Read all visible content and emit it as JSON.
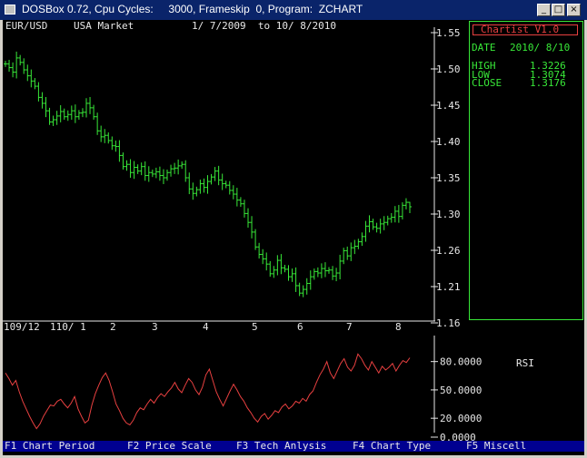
{
  "window": {
    "title": "DOSBox 0.72, Cpu Cycles:     3000, Frameskip  0, Program:  ZCHART",
    "minimize_glyph": "_",
    "maximize_glyph": "□",
    "close_glyph": "×"
  },
  "header": {
    "symbol": "EUR/USD",
    "market": "USA Market",
    "date_range": "1/ 7/2009  to 10/ 8/2010"
  },
  "info_panel": {
    "brand": "Chartist V1.0",
    "date_label": "DATE",
    "date_value": "2010/ 8/10",
    "high_label": "HIGH",
    "high_value": "1.3226",
    "low_label": "LOW",
    "low_value": "1.3074",
    "close_label": "CLOSE",
    "close_value": "1.3176"
  },
  "rsi": {
    "label": "RSI",
    "tick_labels": [
      "80.0000",
      "50.0000",
      "20.0000",
      "0.0000"
    ]
  },
  "function_keys": [
    {
      "key": "F1",
      "label": "Chart Period"
    },
    {
      "key": "F2",
      "label": "Price Scale"
    },
    {
      "key": "F3",
      "label": "Tech Anlysis"
    },
    {
      "key": "F4",
      "label": "Chart Type"
    },
    {
      "key": "F5",
      "label": "Miscell"
    }
  ],
  "colors": {
    "price_bars": "#38e838",
    "rsi_line": "#e84040",
    "axis": "#e8e8e8",
    "fkey_bar": "#000090"
  },
  "chart_data": [
    {
      "type": "bar",
      "title": "EUR/USD",
      "ylim": [
        1.16,
        1.55
      ],
      "y_tick_labels": [
        "1.55",
        "1.50",
        "1.45",
        "1.40",
        "1.35",
        "1.30",
        "1.26",
        "1.21",
        "1.16"
      ],
      "x_tick_labels": [
        "109/12",
        "110/ 1",
        "2",
        "3",
        "4",
        "5",
        "6",
        "7",
        "8"
      ],
      "close_series": [
        1.508,
        1.503,
        1.497,
        1.516,
        1.51,
        1.5,
        1.492,
        1.485,
        1.478,
        1.463,
        1.455,
        1.445,
        1.43,
        1.433,
        1.438,
        1.444,
        1.437,
        1.44,
        1.445,
        1.437,
        1.442,
        1.443,
        1.455,
        1.449,
        1.437,
        1.418,
        1.41,
        1.412,
        1.405,
        1.398,
        1.397,
        1.385,
        1.37,
        1.373,
        1.362,
        1.369,
        1.364,
        1.37,
        1.358,
        1.362,
        1.36,
        1.363,
        1.358,
        1.355,
        1.362,
        1.367,
        1.368,
        1.371,
        1.373,
        1.355,
        1.34,
        1.334,
        1.339,
        1.347,
        1.342,
        1.35,
        1.356,
        1.364,
        1.352,
        1.347,
        1.345,
        1.338,
        1.333,
        1.325,
        1.32,
        1.307,
        1.295,
        1.282,
        1.262,
        1.252,
        1.246,
        1.239,
        1.226,
        1.231,
        1.244,
        1.234,
        1.232,
        1.222,
        1.226,
        1.21,
        1.2,
        1.205,
        1.213,
        1.222,
        1.229,
        1.227,
        1.233,
        1.23,
        1.231,
        1.223,
        1.227,
        1.243,
        1.257,
        1.25,
        1.261,
        1.263,
        1.269,
        1.276,
        1.29,
        1.296,
        1.289,
        1.287,
        1.293,
        1.295,
        1.3,
        1.302,
        1.31,
        1.303,
        1.318,
        1.322,
        1.316
      ],
      "last_bar": {
        "high": 1.3226,
        "low": 1.3074,
        "close": 1.3176
      }
    },
    {
      "type": "line",
      "title": "RSI",
      "ylim": [
        0,
        100
      ],
      "y_tick_labels": [
        "80.0000",
        "50.0000",
        "20.0000",
        "0.0000"
      ],
      "values": [
        68,
        62,
        55,
        60,
        48,
        38,
        30,
        22,
        15,
        9,
        14,
        22,
        28,
        34,
        33,
        38,
        40,
        35,
        31,
        36,
        43,
        30,
        22,
        15,
        18,
        34,
        46,
        55,
        63,
        68,
        60,
        48,
        35,
        28,
        20,
        15,
        13,
        18,
        26,
        31,
        29,
        35,
        40,
        36,
        42,
        46,
        43,
        48,
        52,
        58,
        51,
        47,
        55,
        62,
        58,
        50,
        45,
        53,
        66,
        72,
        60,
        48,
        40,
        33,
        41,
        49,
        56,
        50,
        43,
        38,
        31,
        26,
        20,
        16,
        22,
        25,
        19,
        23,
        28,
        26,
        32,
        35,
        30,
        33,
        38,
        36,
        41,
        38,
        45,
        49,
        58,
        66,
        72,
        80,
        68,
        62,
        70,
        78,
        83,
        74,
        70,
        76,
        88,
        83,
        76,
        71,
        80,
        74,
        68,
        75,
        71,
        74,
        78,
        70,
        76,
        81,
        79,
        84
      ]
    }
  ]
}
